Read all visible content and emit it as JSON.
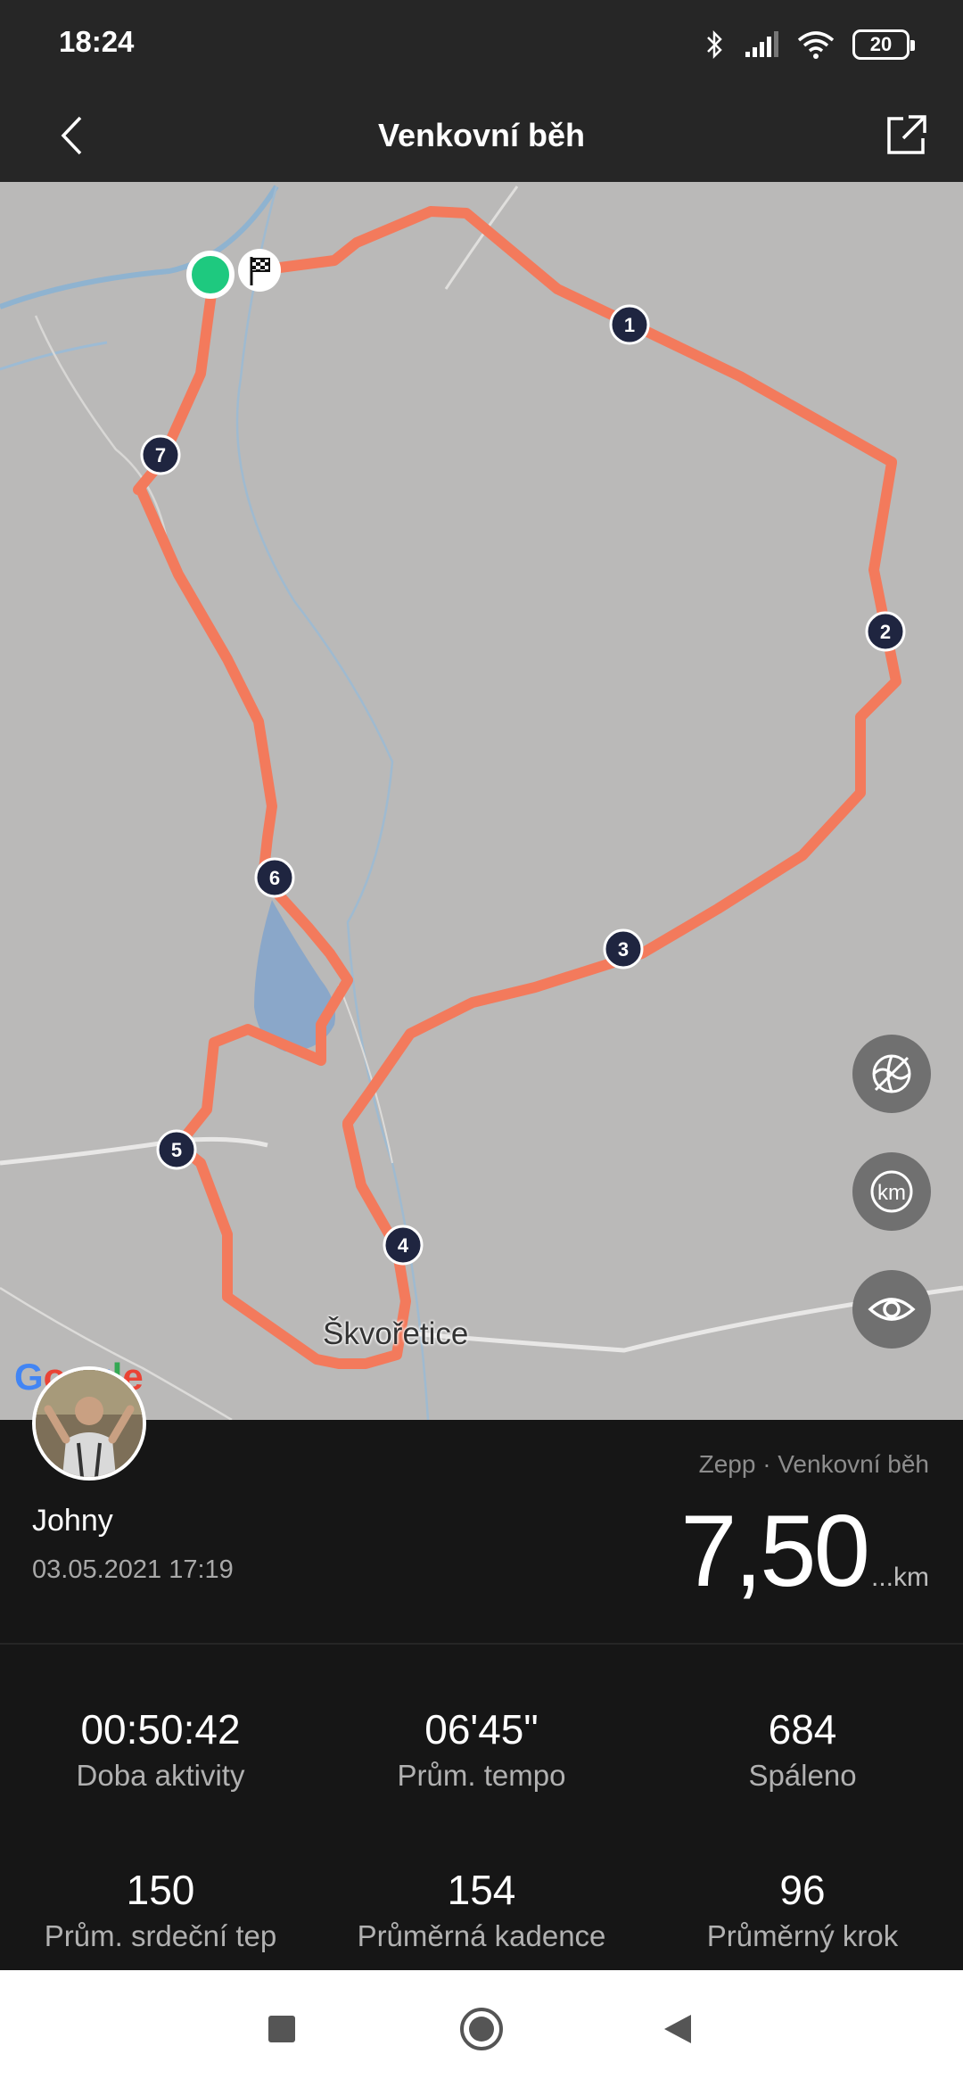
{
  "status_bar": {
    "time": "18:24",
    "battery": "20",
    "icons": [
      "bluetooth-icon",
      "signal-icon",
      "wifi-icon",
      "battery-icon"
    ]
  },
  "header": {
    "title": "Venkovní běh",
    "back_icon": "back-arrow-icon",
    "share_icon": "share-icon"
  },
  "map": {
    "place_label": "Škvořetice",
    "google_logo": "Google",
    "km_markers": [
      "1",
      "2",
      "3",
      "4",
      "5",
      "6",
      "7"
    ],
    "start_icon": "start-point-icon",
    "finish_icon": "finish-flag-icon",
    "route_color": "#f37a5c",
    "buttons": [
      "map-type-icon",
      "km-toggle-icon",
      "visibility-icon"
    ],
    "km_button_label": "km"
  },
  "summary": {
    "user_name": "Johny",
    "date": "03.05.2021 17:19",
    "source": "Zepp · Venkovní běh",
    "distance": "7,50",
    "distance_unit": "...km"
  },
  "stats": [
    {
      "value": "00:50:42",
      "label": "Doba aktivity"
    },
    {
      "value": "06'45\"",
      "label": "Prům. tempo"
    },
    {
      "value": "684",
      "label": "Spáleno"
    },
    {
      "value": "150",
      "label": "Prům. srdeční tep"
    },
    {
      "value": "154",
      "label": "Průměrná kadence"
    },
    {
      "value": "96",
      "label": "Průměrný krok"
    }
  ],
  "nav_bar": {
    "buttons": [
      "recent-apps-icon",
      "home-icon",
      "back-icon"
    ]
  },
  "colors": {
    "accent": "#f37a5c",
    "background": "#161616",
    "header": "#262626",
    "start_green": "#1ec97f",
    "marker": "#1f2540"
  }
}
